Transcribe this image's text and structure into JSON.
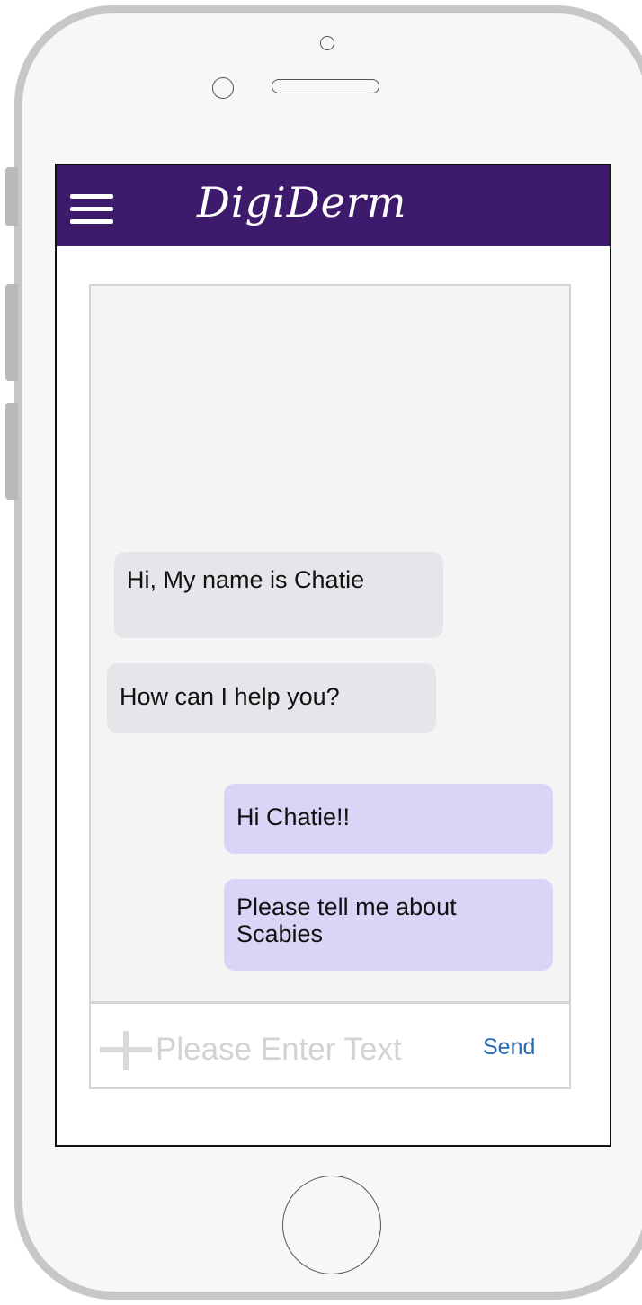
{
  "header": {
    "title": "DigiDerm",
    "menu_icon": "hamburger-menu-icon",
    "background": "#3d1a6b"
  },
  "messages": [
    {
      "sender": "bot",
      "text": "Hi, My name is Chatie"
    },
    {
      "sender": "bot",
      "text": "How can I help you?"
    },
    {
      "sender": "user",
      "text": "Hi Chatie!!"
    },
    {
      "sender": "user",
      "text": "Please tell me about Scabies"
    }
  ],
  "input": {
    "placeholder": "Please Enter Text",
    "value": "",
    "attach_icon": "plus-icon",
    "send_label": "Send"
  },
  "colors": {
    "bot_bubble": "#e6e6ea",
    "user_bubble": "#dcd4f6",
    "send_link": "#2b6ab5"
  }
}
